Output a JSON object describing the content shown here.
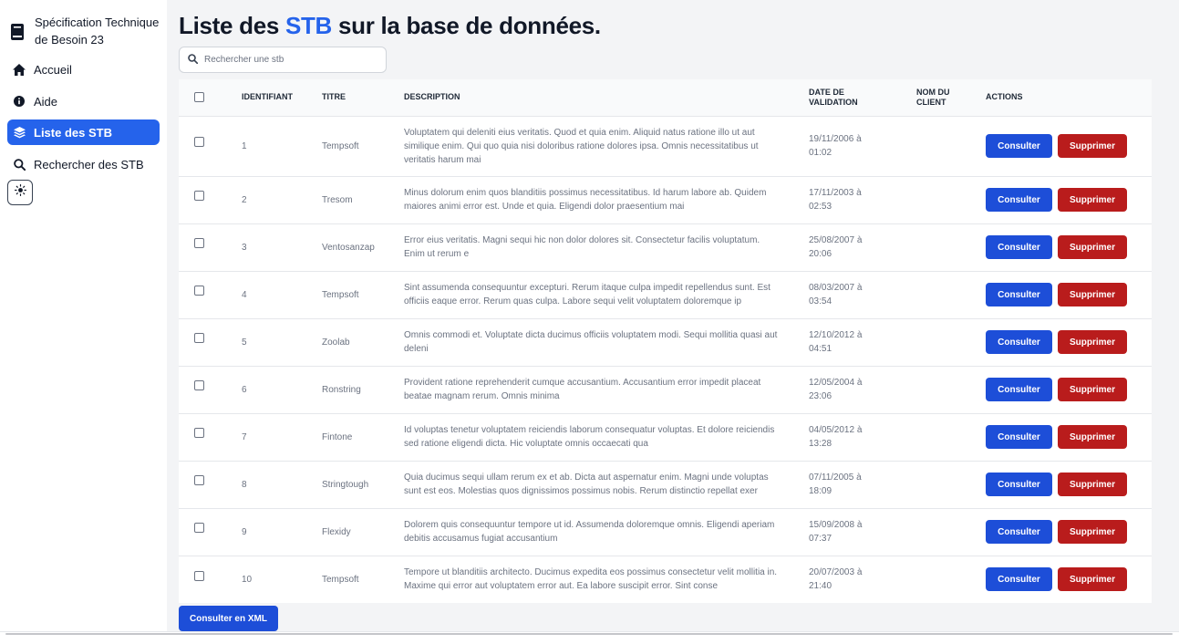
{
  "sidebar": {
    "brand_line1": "Spécification Technique",
    "brand_line2": "de Besoin 23",
    "brand_icon": "book-icon",
    "items": [
      {
        "label": "Accueil",
        "icon": "home-icon",
        "active": false
      },
      {
        "label": "Aide",
        "icon": "info-icon",
        "active": false
      },
      {
        "label": "Liste des STB",
        "icon": "layers-icon",
        "active": true
      },
      {
        "label": "Rechercher des STB",
        "icon": "search-icon",
        "active": false
      }
    ],
    "theme_icon": "sun-icon"
  },
  "page": {
    "title_prefix": "Liste des ",
    "title_accent": "STB",
    "title_suffix": " sur la base de données.",
    "accent_color": "#2563eb"
  },
  "search": {
    "placeholder": "Rechercher une stb",
    "value": ""
  },
  "table": {
    "headers": [
      "IDENTIFIANT",
      "TITRE",
      "DESCRIPTION",
      "DATE DE VALIDATION",
      "NOM DU CLIENT",
      "ACTIONS"
    ],
    "view_label": "Consulter",
    "delete_label": "Supprimer",
    "rows": [
      {
        "id": "1",
        "title": "Tempsoft",
        "description": "Voluptatem qui deleniti eius veritatis. Quod et quia enim. Aliquid natus ratione illo ut aut similique enim. Qui quo quia nisi doloribus ratione dolores ipsa. Omnis necessitatibus ut veritatis harum mai",
        "date": "19/11/2006 à 01:02",
        "client": ""
      },
      {
        "id": "2",
        "title": "Tresom",
        "description": "Minus dolorum enim quos blanditiis possimus necessitatibus. Id harum labore ab. Quidem maiores animi error est. Unde et quia. Eligendi dolor praesentium mai",
        "date": "17/11/2003 à 02:53",
        "client": ""
      },
      {
        "id": "3",
        "title": "Ventosanzap",
        "description": "Error eius veritatis. Magni sequi hic non dolor dolores sit. Consectetur facilis voluptatum. Enim ut rerum e",
        "date": "25/08/2007 à 20:06",
        "client": ""
      },
      {
        "id": "4",
        "title": "Tempsoft",
        "description": "Sint assumenda consequuntur excepturi. Rerum itaque culpa impedit repellendus sunt. Est officiis eaque error. Rerum quas culpa. Labore sequi velit voluptatem doloremque ip",
        "date": "08/03/2007 à 03:54",
        "client": ""
      },
      {
        "id": "5",
        "title": "Zoolab",
        "description": "Omnis commodi et. Voluptate dicta ducimus officiis voluptatem modi. Sequi mollitia quasi aut deleni",
        "date": "12/10/2012 à 04:51",
        "client": ""
      },
      {
        "id": "6",
        "title": "Ronstring",
        "description": "Provident ratione reprehenderit cumque accusantium. Accusantium error impedit placeat beatae magnam rerum. Omnis minima",
        "date": "12/05/2004 à 23:06",
        "client": ""
      },
      {
        "id": "7",
        "title": "Fintone",
        "description": "Id voluptas tenetur voluptatem reiciendis laborum consequatur voluptas. Et dolore reiciendis sed ratione eligendi dicta. Hic voluptate omnis occaecati qua",
        "date": "04/05/2012 à 13:28",
        "client": ""
      },
      {
        "id": "8",
        "title": "Stringtough",
        "description": "Quia ducimus sequi ullam rerum ex et ab. Dicta aut aspernatur enim. Magni unde voluptas sunt est eos. Molestias quos dignissimos possimus nobis. Rerum distinctio repellat exer",
        "date": "07/11/2005 à 18:09",
        "client": ""
      },
      {
        "id": "9",
        "title": "Flexidy",
        "description": "Dolorem quis consequuntur tempore ut id. Assumenda doloremque omnis. Eligendi aperiam debitis accusamus fugiat accusantium",
        "date": "15/09/2008 à 07:37",
        "client": ""
      },
      {
        "id": "10",
        "title": "Tempsoft",
        "description": "Tempore ut blanditiis architecto. Ducimus expedita eos possimus consectetur velit mollitia in. Maxime qui error aut voluptatem error aut. Ea labore suscipit error. Sint conse",
        "date": "20/07/2003 à 21:40",
        "client": ""
      }
    ]
  },
  "xml_button": "Consulter en XML",
  "colors": {
    "primary": "#1d4ed8",
    "danger": "#b91c1c",
    "active_nav": "#2563eb"
  }
}
